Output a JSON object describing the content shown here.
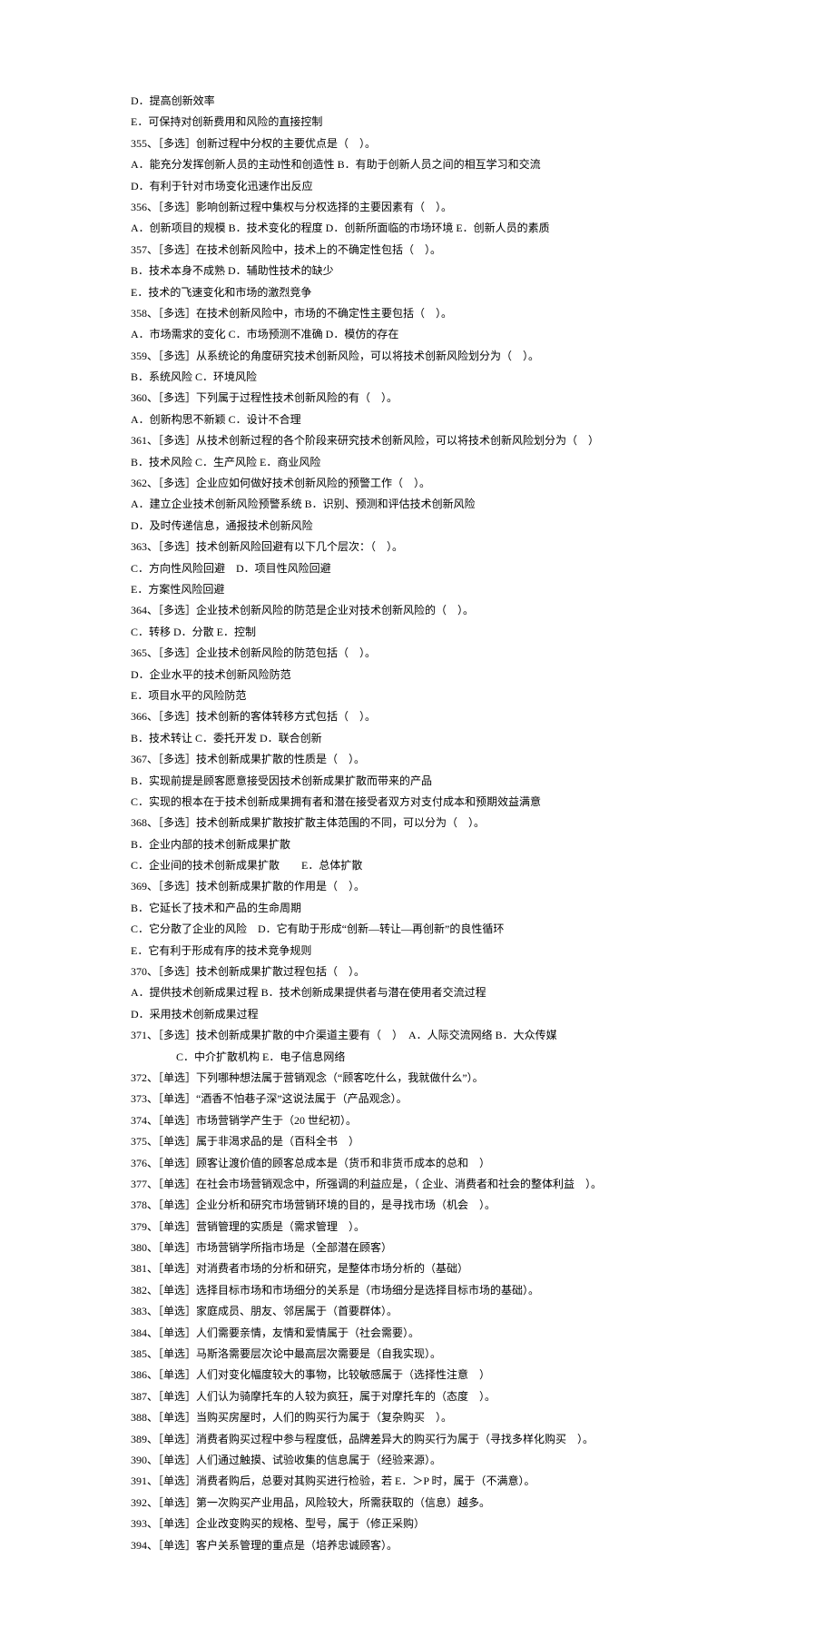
{
  "lines": [
    {
      "t": "D．提高创新效率"
    },
    {
      "t": "E．可保持对创新费用和风险的直接控制"
    },
    {
      "t": "355、［多选］创新过程中分权的主要优点是（　）。"
    },
    {
      "t": "A．能充分发挥创新人员的主动性和创造性 B．有助于创新人员之间的相互学习和交流"
    },
    {
      "t": "D．有利于针对市场变化迅速作出反应"
    },
    {
      "t": "356、［多选］影响创新过程中集权与分权选择的主要因素有（　）。"
    },
    {
      "t": "A．创新项目的规模 B．技术变化的程度 D．创新所面临的市场环境 E．创新人员的素质"
    },
    {
      "t": "357、［多选］在技术创新风险中，技术上的不确定性包括（　）。"
    },
    {
      "t": "B．技术本身不成熟 D．辅助性技术的缺少"
    },
    {
      "t": "E．技术的飞速变化和市场的激烈竞争"
    },
    {
      "t": "358、［多选］在技术创新风险中，市场的不确定性主要包括（　）。"
    },
    {
      "t": "A．市场需求的变化 C．市场预测不准确 D．模仿的存在"
    },
    {
      "t": "359、［多选］从系统论的角度研究技术创新风险，可以将技术创新风险划分为（　）。"
    },
    {
      "t": "B．系统风险 C．环境风险"
    },
    {
      "t": "360、［多选］下列属于过程性技术创新风险的有（　）。"
    },
    {
      "t": "A．创新构思不新颖 C．设计不合理"
    },
    {
      "t": "361、［多选］从技术创新过程的各个阶段来研究技术创新风险，可以将技术创新风险划分为（　）"
    },
    {
      "t": "B．技术风险 C．生产风险 E．商业风险"
    },
    {
      "t": "362、［多选］企业应如何做好技术创新风险的预警工作（　）。"
    },
    {
      "t": "A．建立企业技术创新风险预警系统 B．识别、预测和评估技术创新风险"
    },
    {
      "t": "D．及时传递信息，通报技术创新风险"
    },
    {
      "t": "363、［多选］技术创新风险回避有以下几个层次：（　）。"
    },
    {
      "t": "C．方向性风险回避　D．项目性风险回避"
    },
    {
      "t": "E．方案性风险回避"
    },
    {
      "t": "364、［多选］企业技术创新风险的防范是企业对技术创新风险的（　）。"
    },
    {
      "t": "C．转移 D．分散 E．控制"
    },
    {
      "t": "365、［多选］企业技术创新风险的防范包括（　）。"
    },
    {
      "t": "D．企业水平的技术创新风险防范"
    },
    {
      "t": "E．项目水平的风险防范"
    },
    {
      "t": "366、［多选］技术创新的客体转移方式包括（　）。"
    },
    {
      "t": "B．技术转让 C．委托开发 D．联合创新"
    },
    {
      "t": "367、［多选］技术创新成果扩散的性质是（　）。"
    },
    {
      "t": "B．实现前提是顾客愿意接受因技术创新成果扩散而带来的产品"
    },
    {
      "t": "C．实现的根本在于技术创新成果拥有者和潜在接受者双方对支付成本和预期效益满意"
    },
    {
      "t": "368、［多选］技术创新成果扩散按扩散主体范围的不同，可以分为（　）。"
    },
    {
      "t": "B．企业内部的技术创新成果扩散"
    },
    {
      "t": "C．企业间的技术创新成果扩散　　E．总体扩散"
    },
    {
      "t": "369、［多选］技术创新成果扩散的作用是（　）。"
    },
    {
      "t": "B．它延长了技术和产品的生命周期"
    },
    {
      "t": "C．它分散了企业的风险　D．它有助于形成“创新—转让—再创新”的良性循环"
    },
    {
      "t": "E．它有利于形成有序的技术竞争规则"
    },
    {
      "t": "370、［多选］技术创新成果扩散过程包括（　）。"
    },
    {
      "t": "A．提供技术创新成果过程 B．技术创新成果提供者与潜在使用者交流过程"
    },
    {
      "t": "D．采用技术创新成果过程"
    },
    {
      "t": "371、［多选］技术创新成果扩散的中介渠道主要有（　）　A．人际交流网络 B．大众传媒"
    },
    {
      "t": "C．中介扩散机构 E．电子信息网络",
      "indent": true
    },
    {
      "t": "372、［单选］下列哪种想法属于营销观念（“顾客吃什么，我就做什么”）。"
    },
    {
      "t": "373、［单选］“酒香不怕巷子深”这说法属于（产品观念）。"
    },
    {
      "t": "374、［单选］市场营销学产生于（20 世纪初）。"
    },
    {
      "t": "375、［单选］属于非渴求品的是（百科全书　）"
    },
    {
      "t": "376、［单选］顾客让渡价值的顾客总成本是（货币和非货币成本的总和　）"
    },
    {
      "t": "377、［单选］在社会市场营销观念中，所强调的利益应是，（ 企业、消费者和社会的整体利益　）。"
    },
    {
      "t": "378、［单选］企业分析和研究市场营销环境的目的，是寻找市场（机会　）。"
    },
    {
      "t": "379、［单选］营销管理的实质是（需求管理　）。"
    },
    {
      "t": "380、［单选］市场营销学所指市场是（全部潜在顾客）"
    },
    {
      "t": "381、［单选］对消费者市场的分析和研究，是整体市场分析的（基础）"
    },
    {
      "t": "382、［单选］选择目标市场和市场细分的关系是（市场细分是选择目标市场的基础）。"
    },
    {
      "t": "383、［单选］家庭成员、朋友、邻居属于（首要群体）。"
    },
    {
      "t": "384、［单选］人们需要亲情，友情和爱情属于（社会需要）。"
    },
    {
      "t": "385、［单选］马斯洛需要层次论中最高层次需要是（自我实现）。"
    },
    {
      "t": "386、［单选］人们对变化幅度较大的事物，比较敏感属于（选择性注意　）"
    },
    {
      "t": "387、［单选］人们认为骑摩托车的人较为疯狂，属于对摩托车的（态度　）。"
    },
    {
      "t": "388、［单选］当购买房屋时，人们的购买行为属于（复杂购买　）。"
    },
    {
      "t": "389、［单选］消费者购买过程中参与程度低，品牌差异大的购买行为属于（寻找多样化购买　）。"
    },
    {
      "t": "390、［单选］人们通过触摸、试验收集的信息属于（经验来源）。"
    },
    {
      "t": "391、［单选］消费者购后，总要对其购买进行检验，若 E．＞P 时，属于（不满意）。"
    },
    {
      "t": "392、［单选］第一次购买产业用品，风险较大，所需获取的（信息）越多。"
    },
    {
      "t": "393、［单选］企业改变购买的规格、型号，属于（修正采购）"
    },
    {
      "t": "394、［单选］客户关系管理的重点是（培养忠诚顾客）。"
    }
  ]
}
